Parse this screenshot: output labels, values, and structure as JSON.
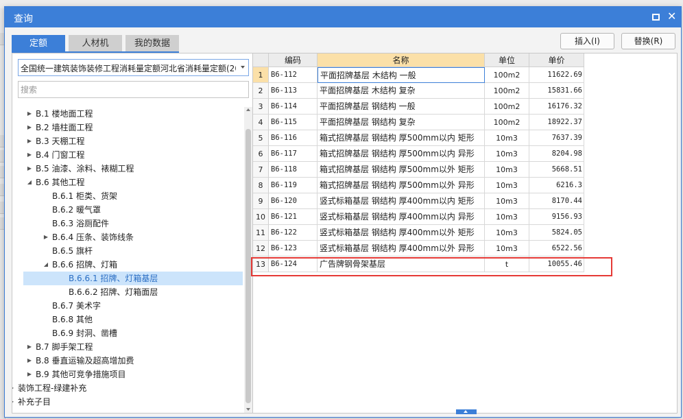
{
  "dialog": {
    "title": "查询"
  },
  "tabs": [
    {
      "label": "定额",
      "active": true
    },
    {
      "label": "人材机",
      "active": false
    },
    {
      "label": "我的数据",
      "active": false
    }
  ],
  "actions": {
    "insert_label": "插入(I)",
    "replace_label": "替换(R)"
  },
  "quota_library": {
    "selected": "全国统一建筑装饰装修工程消耗量定额河北省消耗量定额(20"
  },
  "search": {
    "placeholder": "搜索"
  },
  "tree": [
    {
      "label": "B.1 楼地面工程",
      "level": 1,
      "expander": "collapsed"
    },
    {
      "label": "B.2 墙柱面工程",
      "level": 1,
      "expander": "collapsed"
    },
    {
      "label": "B.3 天棚工程",
      "level": 1,
      "expander": "collapsed"
    },
    {
      "label": "B.4 门窗工程",
      "level": 1,
      "expander": "collapsed"
    },
    {
      "label": "B.5 油漆、涂料、裱糊工程",
      "level": 1,
      "expander": "collapsed"
    },
    {
      "label": "B.6 其他工程",
      "level": 1,
      "expander": "expanded"
    },
    {
      "label": "B.6.1 柜类、货架",
      "level": 2,
      "expander": "none"
    },
    {
      "label": "B.6.2 暖气罩",
      "level": 2,
      "expander": "none"
    },
    {
      "label": "B.6.3 浴厕配件",
      "level": 2,
      "expander": "none"
    },
    {
      "label": "B.6.4 压条、装饰线条",
      "level": 2,
      "expander": "collapsed"
    },
    {
      "label": "B.6.5 旗杆",
      "level": 2,
      "expander": "none"
    },
    {
      "label": "B.6.6 招牌、灯箱",
      "level": 2,
      "expander": "expanded"
    },
    {
      "label": "B.6.6.1 招牌、灯箱基层",
      "level": 3,
      "expander": "none",
      "selected": true
    },
    {
      "label": "B.6.6.2 招牌、灯箱面层",
      "level": 3,
      "expander": "none"
    },
    {
      "label": "B.6.7 美术字",
      "level": 2,
      "expander": "none"
    },
    {
      "label": "B.6.8 其他",
      "level": 2,
      "expander": "none"
    },
    {
      "label": "B.6.9 封洞、凿槽",
      "level": 2,
      "expander": "none"
    },
    {
      "label": "B.7 脚手架工程",
      "level": 1,
      "expander": "collapsed"
    },
    {
      "label": "B.8 垂直运输及超高增加费",
      "level": 1,
      "expander": "collapsed"
    },
    {
      "label": "B.9 其他可竞争措施项目",
      "level": 1,
      "expander": "collapsed"
    },
    {
      "label": "装饰工程-绿建补充",
      "level": 0,
      "expander": "collapsed"
    },
    {
      "label": "补充子目",
      "level": 0,
      "expander": "collapsed"
    }
  ],
  "grid": {
    "columns": [
      "编码",
      "名称",
      "单位",
      "单价"
    ],
    "rows": [
      {
        "num": "1",
        "code": "B6-112",
        "name": "平面招牌基层 木结构 一般",
        "unit": "100m2",
        "price": "11622.69"
      },
      {
        "num": "2",
        "code": "B6-113",
        "name": "平面招牌基层 木结构 复杂",
        "unit": "100m2",
        "price": "15831.66"
      },
      {
        "num": "3",
        "code": "B6-114",
        "name": "平面招牌基层 钢结构 一般",
        "unit": "100m2",
        "price": "16176.32"
      },
      {
        "num": "4",
        "code": "B6-115",
        "name": "平面招牌基层 钢结构 复杂",
        "unit": "100m2",
        "price": "18922.37"
      },
      {
        "num": "5",
        "code": "B6-116",
        "name": "箱式招牌基层 钢结构 厚500mm以内 矩形",
        "unit": "10m3",
        "price": "7637.39"
      },
      {
        "num": "6",
        "code": "B6-117",
        "name": "箱式招牌基层 钢结构 厚500mm以内 异形",
        "unit": "10m3",
        "price": "8204.98"
      },
      {
        "num": "7",
        "code": "B6-118",
        "name": "箱式招牌基层 钢结构 厚500mm以外 矩形",
        "unit": "10m3",
        "price": "5668.51"
      },
      {
        "num": "8",
        "code": "B6-119",
        "name": "箱式招牌基层 钢结构 厚500mm以外 异形",
        "unit": "10m3",
        "price": "6216.3"
      },
      {
        "num": "9",
        "code": "B6-120",
        "name": "竖式标箱基层 钢结构 厚400mm以内 矩形",
        "unit": "10m3",
        "price": "8170.44"
      },
      {
        "num": "10",
        "code": "B6-121",
        "name": "竖式标箱基层 钢结构 厚400mm以内 异形",
        "unit": "10m3",
        "price": "9156.93"
      },
      {
        "num": "11",
        "code": "B6-122",
        "name": "竖式标箱基层 钢结构 厚400mm以外 矩形",
        "unit": "10m3",
        "price": "5824.05"
      },
      {
        "num": "12",
        "code": "B6-123",
        "name": "竖式标箱基层 钢结构 厚400mm以外 异形",
        "unit": "10m3",
        "price": "6522.56"
      },
      {
        "num": "13",
        "code": "B6-124",
        "name": "广告牌钢骨架基层",
        "unit": "t",
        "price": "10055.46"
      }
    ]
  },
  "colors": {
    "accent": "#3c7fd8",
    "selection": "#cce4fb",
    "header_active": "#fbe0a8",
    "highlight": "#e53935"
  }
}
